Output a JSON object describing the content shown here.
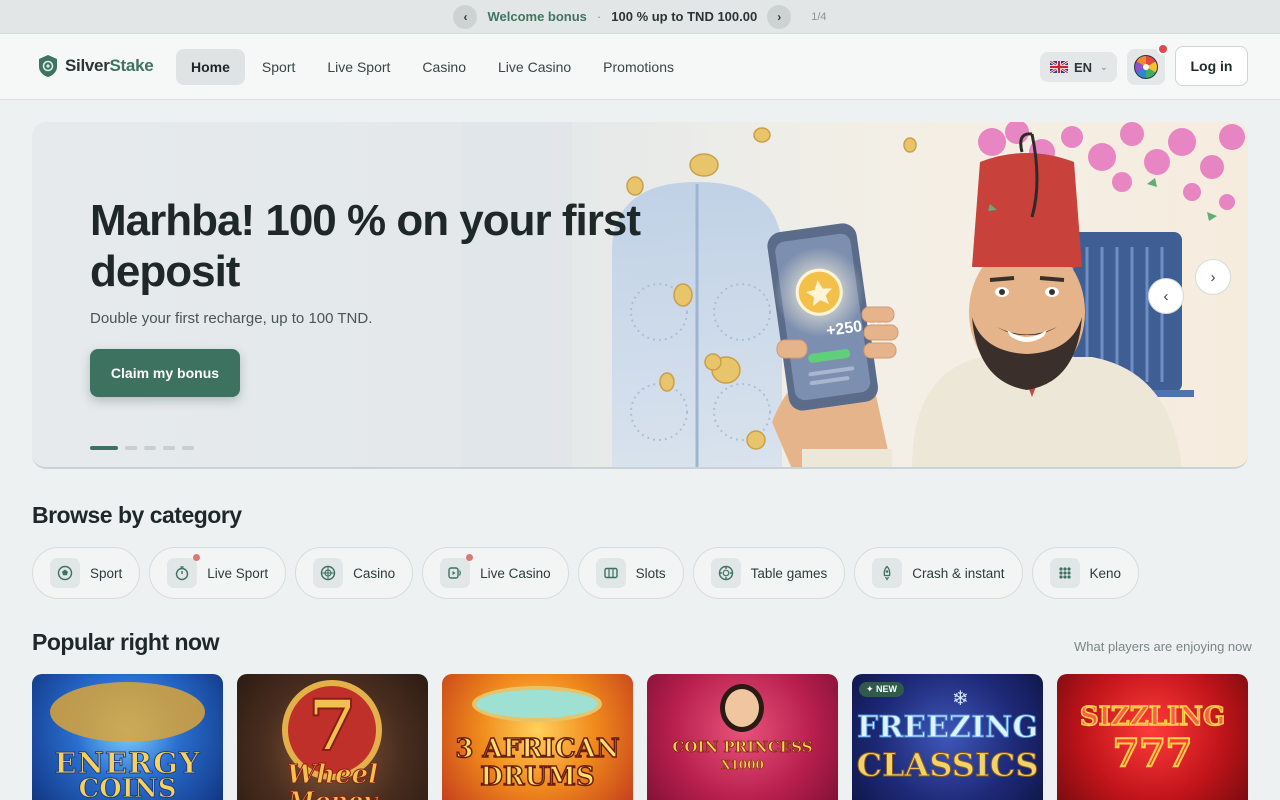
{
  "promo": {
    "title": "Welcome bonus",
    "separator": "·",
    "description": "100 % up to TND 100.00",
    "counter": "1/4",
    "prev": "‹",
    "next": "›"
  },
  "header": {
    "logo_part1": "Silver",
    "logo_part2": "Stake",
    "nav": [
      "Home",
      "Sport",
      "Live Sport",
      "Casino",
      "Live Casino",
      "Promotions"
    ],
    "active_nav": "Home",
    "language": "EN",
    "login_label": "Log in"
  },
  "hero": {
    "title": "Marhba! 100 % on your first deposit",
    "subtitle": "Double your first recharge, up to 100 TND.",
    "cta_label": "Claim my bonus",
    "phone_text": "+250 DT",
    "slide_count": 5,
    "active_slide": 1,
    "prev": "‹",
    "next": "›"
  },
  "categories": {
    "title": "Browse by category",
    "items": [
      {
        "label": "Sport",
        "icon": "soccer-ball-icon",
        "live": false
      },
      {
        "label": "Live Sport",
        "icon": "stopwatch-icon",
        "live": true
      },
      {
        "label": "Casino",
        "icon": "roulette-icon",
        "live": false
      },
      {
        "label": "Live Casino",
        "icon": "live-video-icon",
        "live": true
      },
      {
        "label": "Slots",
        "icon": "slot-machine-icon",
        "live": false
      },
      {
        "label": "Table games",
        "icon": "poker-chip-icon",
        "live": false
      },
      {
        "label": "Crash & instant",
        "icon": "rocket-icon",
        "live": false
      },
      {
        "label": "Keno",
        "icon": "keno-grid-icon",
        "live": false
      }
    ]
  },
  "popular": {
    "title": "Popular right now",
    "hint": "What players are enjoying now",
    "games": [
      {
        "title_line1": "ENERGY",
        "title_line2": "COINS",
        "badge": ""
      },
      {
        "title_line1": "Wheel",
        "title_line2": "Money",
        "badge": ""
      },
      {
        "title_line1": "3 AFRICAN",
        "title_line2": "DRUMS",
        "badge": ""
      },
      {
        "title_line1": "COIN PRINCESS",
        "title_line2": "X1000",
        "badge": ""
      },
      {
        "title_line1": "FREEZING",
        "title_line2": "CLASSICS",
        "badge": "✦ NEW"
      },
      {
        "title_line1": "SIZZLING",
        "title_line2": "777",
        "badge": ""
      }
    ]
  },
  "colors": {
    "brand": "#3d7261",
    "background": "#eef1f1",
    "notification": "#e0474f"
  }
}
